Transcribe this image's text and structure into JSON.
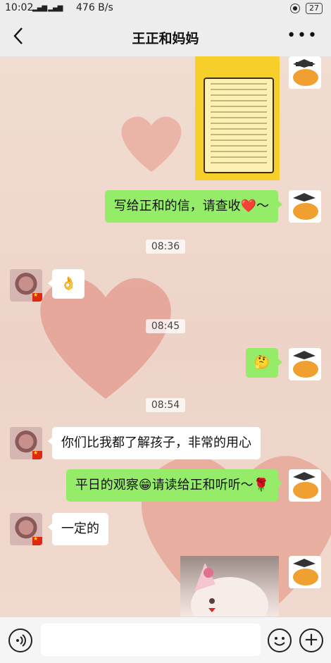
{
  "status_bar": {
    "time": "10:02",
    "network_speed": "476 B/s",
    "battery": "27"
  },
  "nav": {
    "title": "王正和妈妈"
  },
  "messages": [
    {
      "type": "image",
      "from": "me",
      "content": "letter-image"
    },
    {
      "type": "text",
      "from": "me",
      "text": "写给正和的信，请查收❤️～"
    },
    {
      "type": "time",
      "text": "08:36"
    },
    {
      "type": "emoji",
      "from": "other",
      "text": "👌"
    },
    {
      "type": "time",
      "text": "08:45"
    },
    {
      "type": "emoji",
      "from": "me",
      "text": "🤔"
    },
    {
      "type": "time",
      "text": "08:54"
    },
    {
      "type": "text",
      "from": "other",
      "text": "你们比我都了解孩子，非常的用心"
    },
    {
      "type": "text",
      "from": "me",
      "text": "平日的观察😁请读给正和听听～🌹"
    },
    {
      "type": "text",
      "from": "other",
      "text": "一定的"
    },
    {
      "type": "image",
      "from": "me",
      "content": "cat-photo"
    }
  ],
  "input": {
    "placeholder": ""
  },
  "icons": {
    "back": "back-arrow-icon",
    "more": "more-icon",
    "voice": "voice-icon",
    "emoji": "emoji-icon",
    "plus": "plus-icon"
  },
  "colors": {
    "my_bubble": "#95ec69",
    "other_bubble": "#ffffff",
    "bar": "#ededed"
  }
}
